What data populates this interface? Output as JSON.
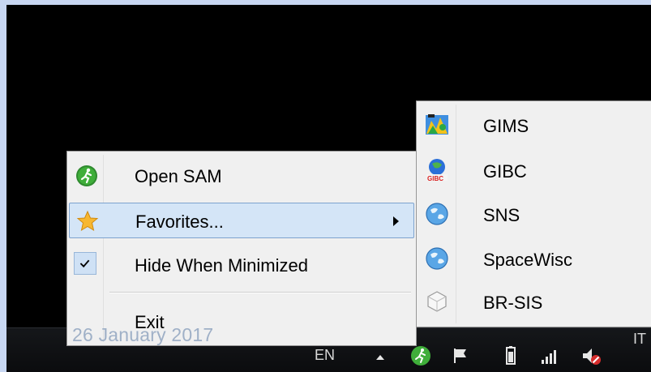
{
  "context_menu": {
    "items": [
      {
        "label": "Open SAM",
        "icon": "runner-icon"
      },
      {
        "label": "Favorites...",
        "icon": "star-icon",
        "has_submenu": true,
        "highlighted": true
      },
      {
        "label": "Hide When Minimized",
        "icon": "check-icon",
        "checked": true
      },
      {
        "label": "Exit"
      }
    ]
  },
  "favorites_submenu": {
    "items": [
      {
        "label": "GIMS",
        "icon": "gims-icon"
      },
      {
        "label": "GIBC",
        "icon": "gibc-icon"
      },
      {
        "label": "SNS",
        "icon": "globe-icon"
      },
      {
        "label": "SpaceWisc",
        "icon": "globe-icon"
      },
      {
        "label": "BR-SIS",
        "icon": "cube-icon"
      }
    ]
  },
  "taskbar": {
    "language": "EN",
    "right_label": "IT",
    "date_text": "26 January 2017",
    "tray_icons": [
      "up-arrow-icon",
      "runner-icon",
      "flag-icon",
      "battery-icon",
      "signal-icon",
      "volume-muted-icon"
    ]
  },
  "colors": {
    "desktop": "#000000",
    "frame": "#c8d7f2",
    "menu_bg": "#f0f0f0",
    "highlight": "#d4e5f7",
    "date_text": "#9fb0c7"
  }
}
